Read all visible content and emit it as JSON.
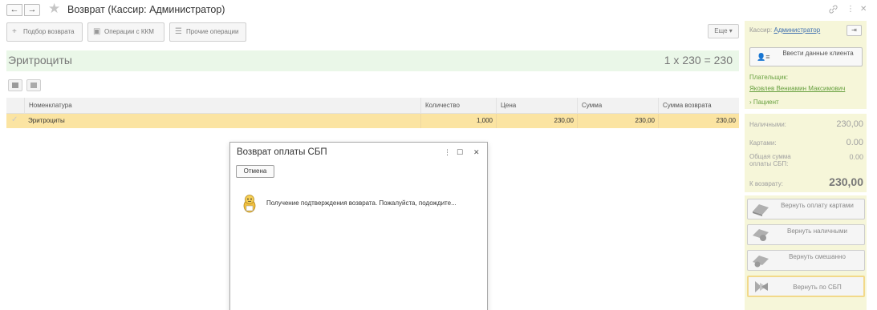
{
  "window": {
    "title": "Возврат (Кассир: Администратор)",
    "nav_back": "←",
    "nav_forward": "→"
  },
  "toolbar": {
    "btn_select_return": "Подбор возврата",
    "btn_kkm": "Операции с ККМ",
    "btn_other": "Прочие операции",
    "btn_more": "Еще"
  },
  "banner": {
    "item_name": "Эритроциты",
    "total_expr": "1 x 230 = 230"
  },
  "table": {
    "headers": [
      "Номенклатура",
      "Количество",
      "Цена",
      "Сумма",
      "Сумма возврата"
    ],
    "rows": [
      {
        "name": "Эритроциты",
        "qty": "1,000",
        "price": "230,00",
        "sum": "230,00",
        "return_sum": "230,00"
      }
    ]
  },
  "modal": {
    "title": "Возврат оплаты СБП",
    "cancel_label": "Отмена",
    "message": "Получение подтверждения возврата. Пожалуйста, подождите..."
  },
  "right_panel": {
    "cashier_label": "Кассир:",
    "cashier_name": "Администратор",
    "client_button": "Ввести данные клиента",
    "payer_label": "Плательщик:",
    "payer_name": "Яковлев Вениамин Максимович",
    "patient_label": "Пациент",
    "cash_label": "Наличными:",
    "cash_value": "230,00",
    "cards_label": "Картами:",
    "cards_value": "0.00",
    "sbp_total_label": "Общая сумма оплаты СБП:",
    "sbp_total_value": "0.00",
    "to_return_label": "К возврату:",
    "to_return_value": "230,00",
    "btn_return_cards": "Вернуть оплату картами",
    "btn_return_cash": "Вернуть наличными",
    "btn_return_mixed": "Вернуть смешанно",
    "btn_return_sbp": "Вернуть по СБП"
  },
  "colors": {
    "banner_bg": "#eaf7e8",
    "selected_row": "#fbe4a2",
    "panel_bg": "#f6f6d9",
    "link": "#4070b0"
  }
}
